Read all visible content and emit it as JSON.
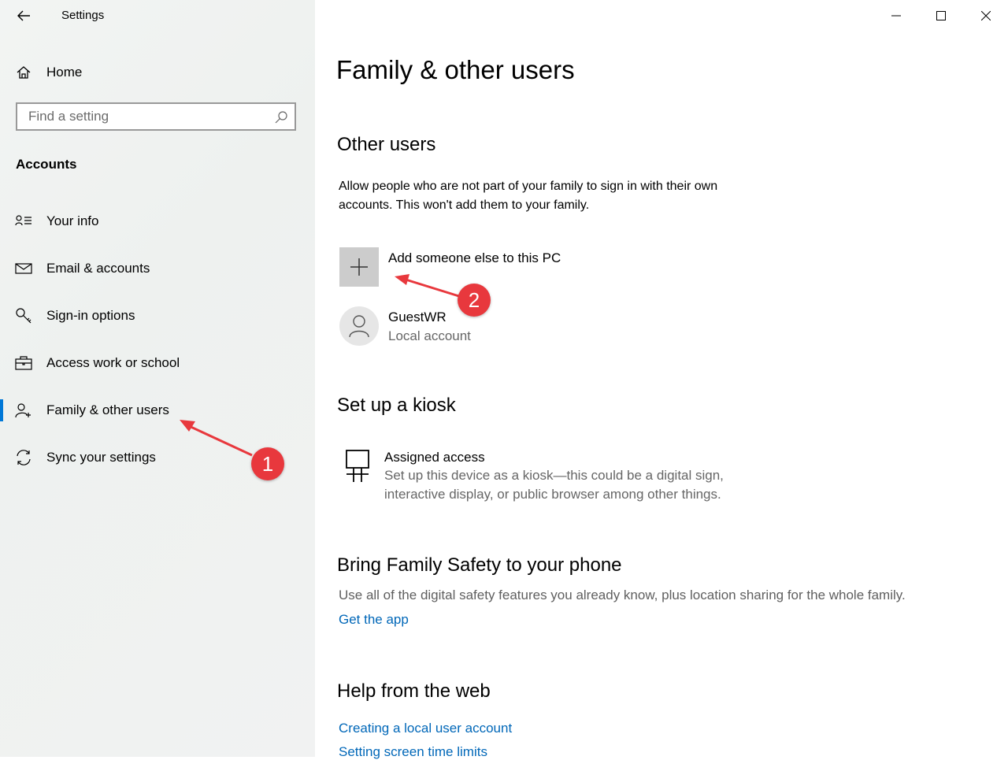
{
  "app": {
    "title": "Settings"
  },
  "sidebar": {
    "home_label": "Home",
    "search_placeholder": "Find a setting",
    "section_heading": "Accounts",
    "items": [
      {
        "label": "Your info",
        "icon": "person-list-icon"
      },
      {
        "label": "Email & accounts",
        "icon": "envelope-icon"
      },
      {
        "label": "Sign-in options",
        "icon": "key-icon"
      },
      {
        "label": "Access work or school",
        "icon": "briefcase-icon"
      },
      {
        "label": "Family & other users",
        "icon": "person-add-icon",
        "active": true
      },
      {
        "label": "Sync your settings",
        "icon": "sync-icon"
      }
    ]
  },
  "main": {
    "page_title": "Family & other users",
    "other_users": {
      "heading": "Other users",
      "description_line1": "Allow people who are not part of your family to sign in with their own",
      "description_line2": "accounts. This won't add them to your family.",
      "add_label": "Add someone else to this PC",
      "user": {
        "name": "GuestWR",
        "type": "Local account"
      }
    },
    "kiosk": {
      "heading": "Set up a kiosk",
      "title": "Assigned access",
      "desc_line1": "Set up this device as a kiosk—this could be a digital sign,",
      "desc_line2": "interactive display, or public browser among other things."
    },
    "family_safety": {
      "heading": "Bring Family Safety to your phone",
      "description": "Use all of the digital safety features you already know, plus location sharing for the whole family.",
      "link": "Get the app"
    },
    "help": {
      "heading": "Help from the web",
      "links": [
        "Creating a local user account",
        "Setting screen time limits"
      ]
    }
  },
  "annotations": {
    "badge1": "1",
    "badge2": "2"
  },
  "colors": {
    "accent": "#0078d7",
    "link": "#0067b8",
    "annotation": "#e8383d"
  }
}
